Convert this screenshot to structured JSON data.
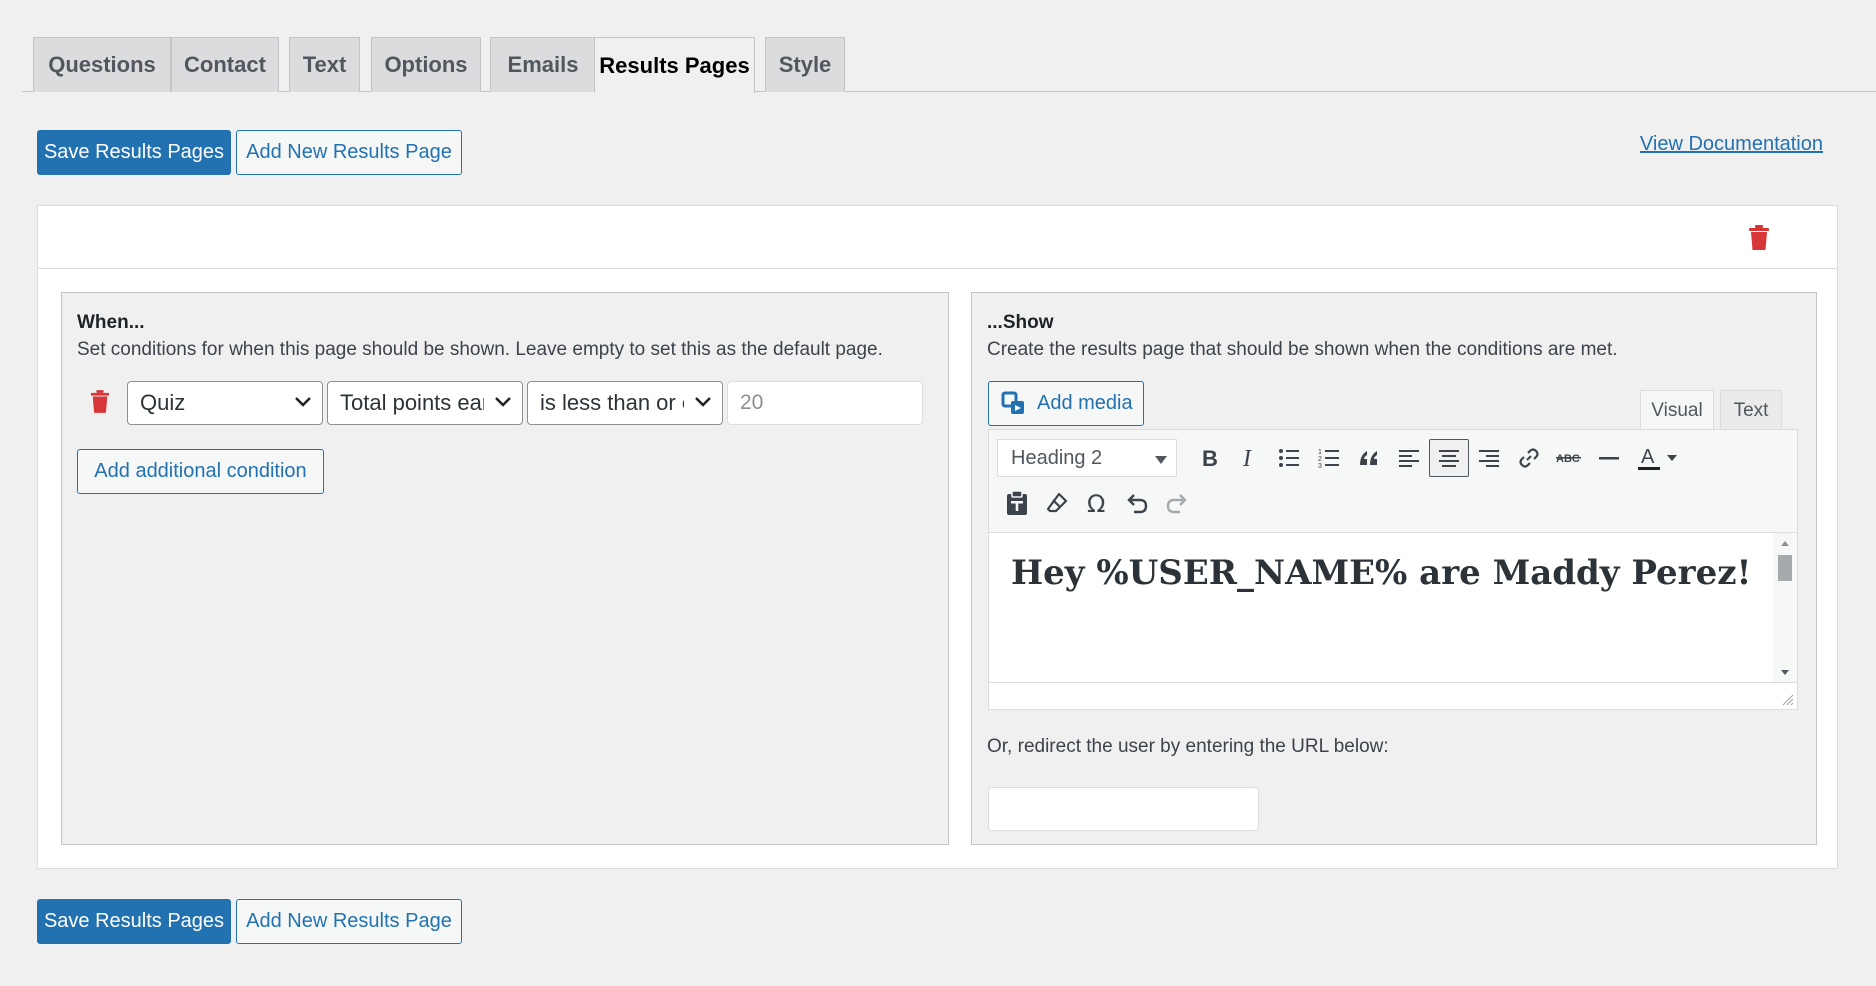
{
  "tabs": [
    {
      "label": "Questions"
    },
    {
      "label": "Contact"
    },
    {
      "label": "Text"
    },
    {
      "label": "Options"
    },
    {
      "label": "Emails"
    },
    {
      "label": "Results Pages",
      "active": true
    },
    {
      "label": "Style"
    }
  ],
  "actions": {
    "save_label": "Save Results Pages",
    "add_label": "Add New Results Page",
    "doc_link": "View Documentation"
  },
  "when_panel": {
    "title": "When...",
    "description": "Set conditions for when this page should be shown. Leave empty to set this as the default page.",
    "condition": {
      "category": "Quiz",
      "metric": "Total points earned",
      "operator": "is less than or equal to",
      "value": "20"
    },
    "add_condition_label": "Add additional condition"
  },
  "show_panel": {
    "title": "...Show",
    "description": "Create the results page that should be shown when the conditions are met.",
    "add_media_label": "Add media",
    "editor_tabs": {
      "visual": "Visual",
      "text": "Text"
    },
    "format_select": "Heading 2",
    "content_heading": "Hey %USER_NAME% are Maddy Perez!",
    "redirect_label": "Or, redirect the user by entering the URL below:",
    "redirect_value": ""
  },
  "colors": {
    "accent": "#2271b1",
    "danger": "#d63638",
    "background": "#f0f0f1"
  },
  "icons": {
    "delete": "trash-icon",
    "media": "media-icon"
  }
}
